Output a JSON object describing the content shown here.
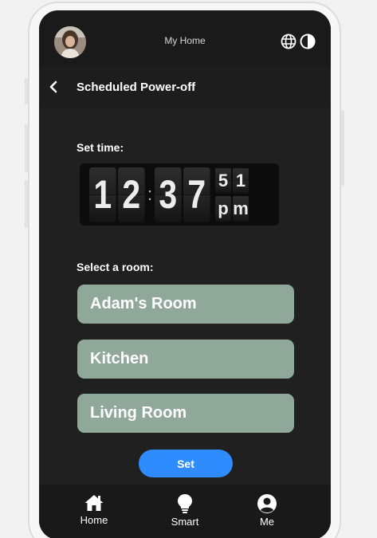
{
  "header": {
    "app_title": "My Home",
    "avatar": "user-avatar",
    "icons": [
      "globe-icon",
      "contrast-icon"
    ]
  },
  "page": {
    "title": "Scheduled Power-off",
    "back_icon": "chevron-left-icon"
  },
  "time": {
    "label": "Set time:",
    "hour_tens": "1",
    "hour_ones": "2",
    "separator": ":",
    "minute_tens": "3",
    "minute_ones": "7",
    "second_tens": "5",
    "second_ones": "1",
    "ampm_first": "p",
    "ampm_second": "m"
  },
  "rooms": {
    "label": "Select a room:",
    "items": [
      "Adam's Room",
      "Kitchen",
      "Living Room"
    ]
  },
  "actions": {
    "set_label": "Set"
  },
  "bottom_nav": {
    "items": [
      {
        "label": "Home",
        "icon": "home-icon"
      },
      {
        "label": "Smart",
        "icon": "lightbulb-icon"
      },
      {
        "label": "Me",
        "icon": "user-circle-icon"
      }
    ]
  },
  "colors": {
    "background": "#202020",
    "room_button": "#8fa89a",
    "accent": "#2f8cff"
  }
}
